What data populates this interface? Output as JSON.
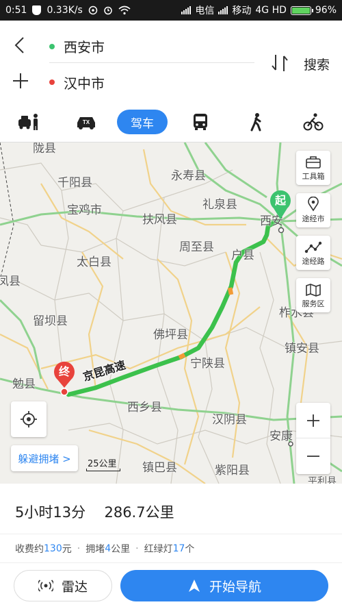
{
  "status_bar": {
    "time": "0:51",
    "speed": "0.33K/s",
    "carrier1": "电信",
    "carrier2": "移动",
    "network": "4G HD",
    "battery": "96%"
  },
  "route": {
    "start": "西安市",
    "end": "汉中市",
    "search_label": "搜索",
    "start_dot_color": "#3cc36f",
    "end_dot_color": "#e8433c"
  },
  "modes": [
    {
      "name": "taxi-icon"
    },
    {
      "name": "tx-car-icon",
      "text": "TX"
    },
    {
      "name": "drive",
      "label": "驾车"
    },
    {
      "name": "bus-icon"
    },
    {
      "name": "walk-icon"
    },
    {
      "name": "bike-icon"
    }
  ],
  "map": {
    "places": {
      "longxian": "陇县",
      "qianyang": "千阳县",
      "yongshou": "永寿县",
      "liquan": "礼泉县",
      "baoji": "宝鸡市",
      "fufeng": "扶风县",
      "xian": "西安",
      "zhouzhi": "周至县",
      "huxian": "户县",
      "taibai": "太白县",
      "fengxian": "凤县",
      "liuba": "留坝县",
      "foping": "佛坪县",
      "zhashui": "柞水县",
      "zhenan": "镇安县",
      "ningshan": "宁陕县",
      "mianxian": "勉县",
      "xixiang": "西乡县",
      "hanyin": "汉阴县",
      "ankang": "安康",
      "zhenba": "镇巴县",
      "ziyang": "紫阳县",
      "pingli": "平利县"
    },
    "road_label": "京昆高速",
    "start_pin": "起",
    "end_pin": "终",
    "tools": [
      {
        "name": "toolbox",
        "label": "工具箱"
      },
      {
        "name": "via-city",
        "label": "途经市"
      },
      {
        "name": "via-road",
        "label": "途经路"
      },
      {
        "name": "service-area",
        "label": "服务区"
      }
    ],
    "avoid_label": "躲避拥堵 >",
    "scale_label": "25公里",
    "route_color": "#3cc14c",
    "congestion_color": "#f29b36"
  },
  "summary": {
    "duration": "5小时13分",
    "distance": "286.7公里"
  },
  "details": {
    "toll_prefix": "收费约",
    "toll_value": "130",
    "toll_suffix": "元",
    "jam_prefix": "拥堵",
    "jam_value": "4",
    "jam_suffix": "公里",
    "lights_prefix": "红绿灯",
    "lights_value": "17",
    "lights_suffix": "个"
  },
  "actions": {
    "radar_label": "雷达",
    "navigate_label": "开始导航"
  },
  "colors": {
    "accent": "#2e86f0"
  }
}
